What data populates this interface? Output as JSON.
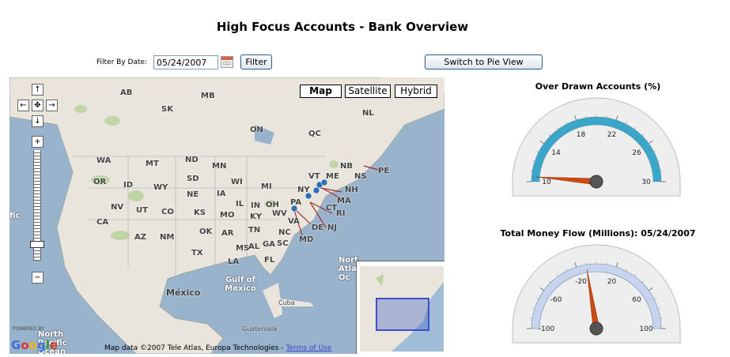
{
  "header": {
    "title": "High Focus Accounts - Bank Overview"
  },
  "filter": {
    "label": "Filter By Date:",
    "date_value": "05/24/2007",
    "button_label": "Filter"
  },
  "view_toggle": {
    "label": "Switch to Pie View"
  },
  "map": {
    "type_buttons": [
      "Map",
      "Satellite",
      "Hybrid"
    ],
    "active_type": "Map",
    "labels": {
      "ab": "AB",
      "sk": "SK",
      "mb": "MB",
      "on": "ON",
      "qc": "QC",
      "nl": "NL",
      "wa": "WA",
      "mt": "MT",
      "nd": "ND",
      "mn": "MN",
      "me": "ME",
      "vt": "VT",
      "nb": "NB",
      "pe": "PE",
      "ns": "NS",
      "or": "OR",
      "id": "ID",
      "wy": "WY",
      "sd": "SD",
      "wi": "WI",
      "mi": "MI",
      "ny": "NY",
      "nh": "NH",
      "ma": "MA",
      "ne": "NE",
      "ia": "IA",
      "il": "IL",
      "in": "IN",
      "oh": "OH",
      "pa": "PA",
      "ct": "CT",
      "ri": "RI",
      "nj": "NJ",
      "de": "DE",
      "md": "MD",
      "nv": "NV",
      "ut": "UT",
      "co": "CO",
      "ks": "KS",
      "mo": "MO",
      "ky": "KY",
      "wv": "WV",
      "va": "VA",
      "ca": "CA",
      "az": "AZ",
      "nm": "NM",
      "ok": "OK",
      "ar": "AR",
      "tn": "TN",
      "nc": "NC",
      "tx": "TX",
      "ms": "MS",
      "al": "AL",
      "ga": "GA",
      "sc": "SC",
      "la": "LA",
      "fl": "FL",
      "mexico": "México",
      "gulf": "Gulf of Mexico",
      "cuba": "Cuba",
      "guatemala": "Guatemala",
      "north_atlantic": "North Atlantic Oc",
      "north_pacific": "North Pacific Ocean",
      "pacific_frag": "fic"
    },
    "powered_by": "POWERED BY",
    "google": "Google",
    "attribution": "Map data ©2007 Tele Atlas, Europa Technologies -",
    "terms_link": "Terms of Use"
  },
  "gauges": [
    {
      "title": "Over Drawn Accounts (%)",
      "min": 10,
      "max": 30,
      "ticks": [
        "10",
        "14",
        "18",
        "22",
        "26",
        "30"
      ],
      "value": 10.5,
      "band_color": "#3aa6c8",
      "needle_color": "#d04a14"
    },
    {
      "title": "Total Money Flow (Millions): 05/24/2007",
      "min": -100,
      "max": 100,
      "ticks": [
        "-100",
        "-60",
        "-20",
        "20",
        "60",
        "100"
      ],
      "value": -10,
      "band_color": "#c8d4ee",
      "needle_color": "#d04a14"
    }
  ]
}
